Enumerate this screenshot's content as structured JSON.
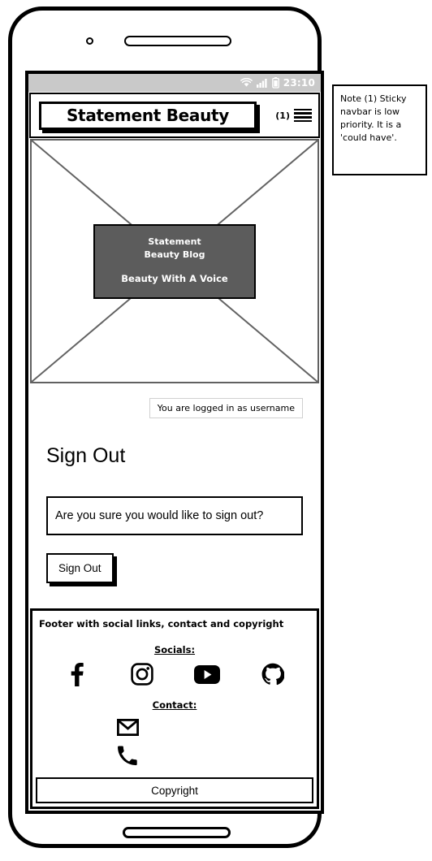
{
  "device": {
    "camera_icon": "camera-dot",
    "speaker_icon": "speaker-grille",
    "home_button_icon": "home-ellipse"
  },
  "status_bar": {
    "wifi_icon": "wifi-icon",
    "signal_icon": "signal-bars-icon",
    "battery_icon": "battery-icon",
    "time": "23:10",
    "bg_color": "#c9c9c9",
    "text_color": "#ffffff"
  },
  "navbar": {
    "brand": "Statement Beauty",
    "note_ref": "(1)",
    "menu_icon": "hamburger-menu-icon"
  },
  "hero": {
    "placeholder_icon": "image-placeholder-cross",
    "overlay": {
      "title_line1": "Statement",
      "title_line2": "Beauty Blog",
      "tagline": "Beauty With A Voice",
      "bg_color": "#5c5c5c",
      "text_color": "#ffffff"
    }
  },
  "main": {
    "login_status": "You are logged in as username",
    "heading": "Sign Out",
    "confirm_message": "Are you sure you would like to sign out?",
    "signout_button": "Sign Out"
  },
  "footer": {
    "note": "Footer with social links, contact and copyright",
    "socials_label": "Socials:",
    "socials": [
      {
        "name": "facebook-icon"
      },
      {
        "name": "instagram-icon"
      },
      {
        "name": "youtube-icon"
      },
      {
        "name": "github-icon"
      }
    ],
    "contact_label": "Contact:",
    "contacts": [
      {
        "name": "email-icon"
      },
      {
        "name": "phone-icon"
      }
    ],
    "copyright": "Copyright"
  },
  "side_note": {
    "text": "Note (1) Sticky navbar is low priority. It is a 'could have'."
  }
}
